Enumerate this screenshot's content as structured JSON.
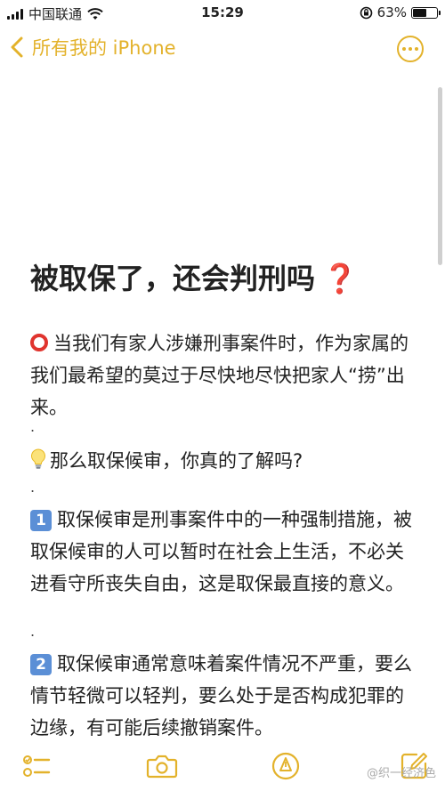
{
  "status_bar": {
    "carrier": "中国联通",
    "time": "15:29",
    "battery_percent": "63%",
    "battery_level": 0.63
  },
  "nav": {
    "back_label": "所有我的 iPhone"
  },
  "note": {
    "title": "被取保了，还会判刑吗",
    "title_suffix": "❓",
    "paragraphs": [
      "当我们有家人涉嫌刑事案件时，作为家属的我们最希望的莫过于尽快地尽快把家人“捞”出来。",
      "那么取保候审，你真的了解吗?",
      "取保候审是刑事案件中的一种强制措施，被取保候审的人可以暂时在社会上生活，不必关进看守所丧失自由，这是取保最直接的意义。",
      "取保候审通常意味着案件情况不严重，要么情节轻微可以轻判，要么处于是否构成犯罪的边缘，有可能后续撤销案件。"
    ],
    "separator": ".",
    "number_badges": [
      "1",
      "2"
    ]
  },
  "watermark": "@织一经济色",
  "icons": {
    "p1": "red-circle-icon",
    "p2": "light-bulb-icon",
    "p3": "keycap-one-icon",
    "p4": "keycap-two-icon"
  },
  "colors": {
    "accent": "#e3b22b",
    "question": "#d9302c",
    "keycap": "#5b8fd6"
  }
}
